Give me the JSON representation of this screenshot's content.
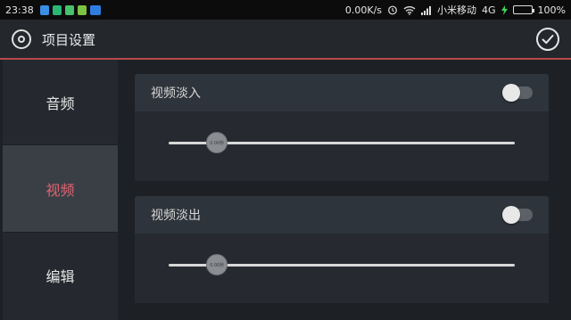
{
  "status_bar": {
    "time": "23:38",
    "net_speed": "0.00K/s",
    "carrier": "小米移动",
    "network": "4G",
    "battery": "100%",
    "battery_level": 1.0,
    "icons": [
      "shield-icon",
      "security-icon",
      "sim-icon",
      "battery-saver-icon",
      "cloud-icon",
      "alarm-icon",
      "wifi-icon",
      "signal-icon",
      "charging-icon"
    ]
  },
  "header": {
    "title": "项目设置",
    "confirm_icon": "check-circle-icon",
    "settings_icon": "target-icon"
  },
  "sidebar": {
    "items": [
      {
        "label": "音频",
        "active": false
      },
      {
        "label": "视频",
        "active": true
      },
      {
        "label": "编辑",
        "active": false
      }
    ]
  },
  "panels": [
    {
      "label": "视频淡入",
      "enabled": false,
      "slider_value_label": "0.00秒",
      "slider_fraction": 0.14
    },
    {
      "label": "视频淡出",
      "enabled": false,
      "slider_value_label": "0.00秒",
      "slider_fraction": 0.14
    }
  ],
  "colors": {
    "accent": "#b8494d",
    "active_tab_text": "#e06470",
    "battery_fill": "#3dd65a"
  }
}
